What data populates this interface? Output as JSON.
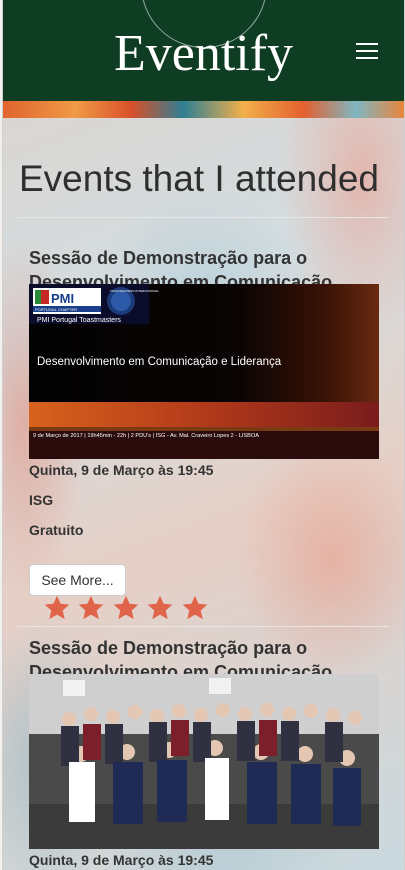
{
  "navbar": {
    "brand": "Eventify"
  },
  "page": {
    "title": "Events that I attended"
  },
  "events": [
    {
      "title": "Sessão de Demonstração para o Desenvolvimento em Comunicação",
      "banner": {
        "org_badge_top": "PMI",
        "org_badge_sub": "PORTUGAL CHAPTER",
        "club_logo_text": "TOASTMASTERS INTERNATIONAL",
        "org_caption": "PMI Portugal Toastmasters",
        "headline": "Desenvolvimento em Comunicação e Liderança",
        "footer": "9 de Março de 2017  |  19h45min - 22h  |  2 PDU's  |  ISG - Av. Mal. Craveiro Lopes 2 - LISBOA"
      },
      "datetime": "Quinta, 9 de Março às 19:45",
      "venue": "ISG",
      "price": "Gratuito",
      "see_more_label": "See More...",
      "rating": 5
    },
    {
      "title": "Sessão de Demonstração para o Desenvolvimento em Comunicação",
      "datetime": "Quinta, 9 de Março às 19:45"
    }
  ],
  "colors": {
    "navbar": "#0f3d24",
    "star": "#e0644a",
    "text": "#333333"
  }
}
